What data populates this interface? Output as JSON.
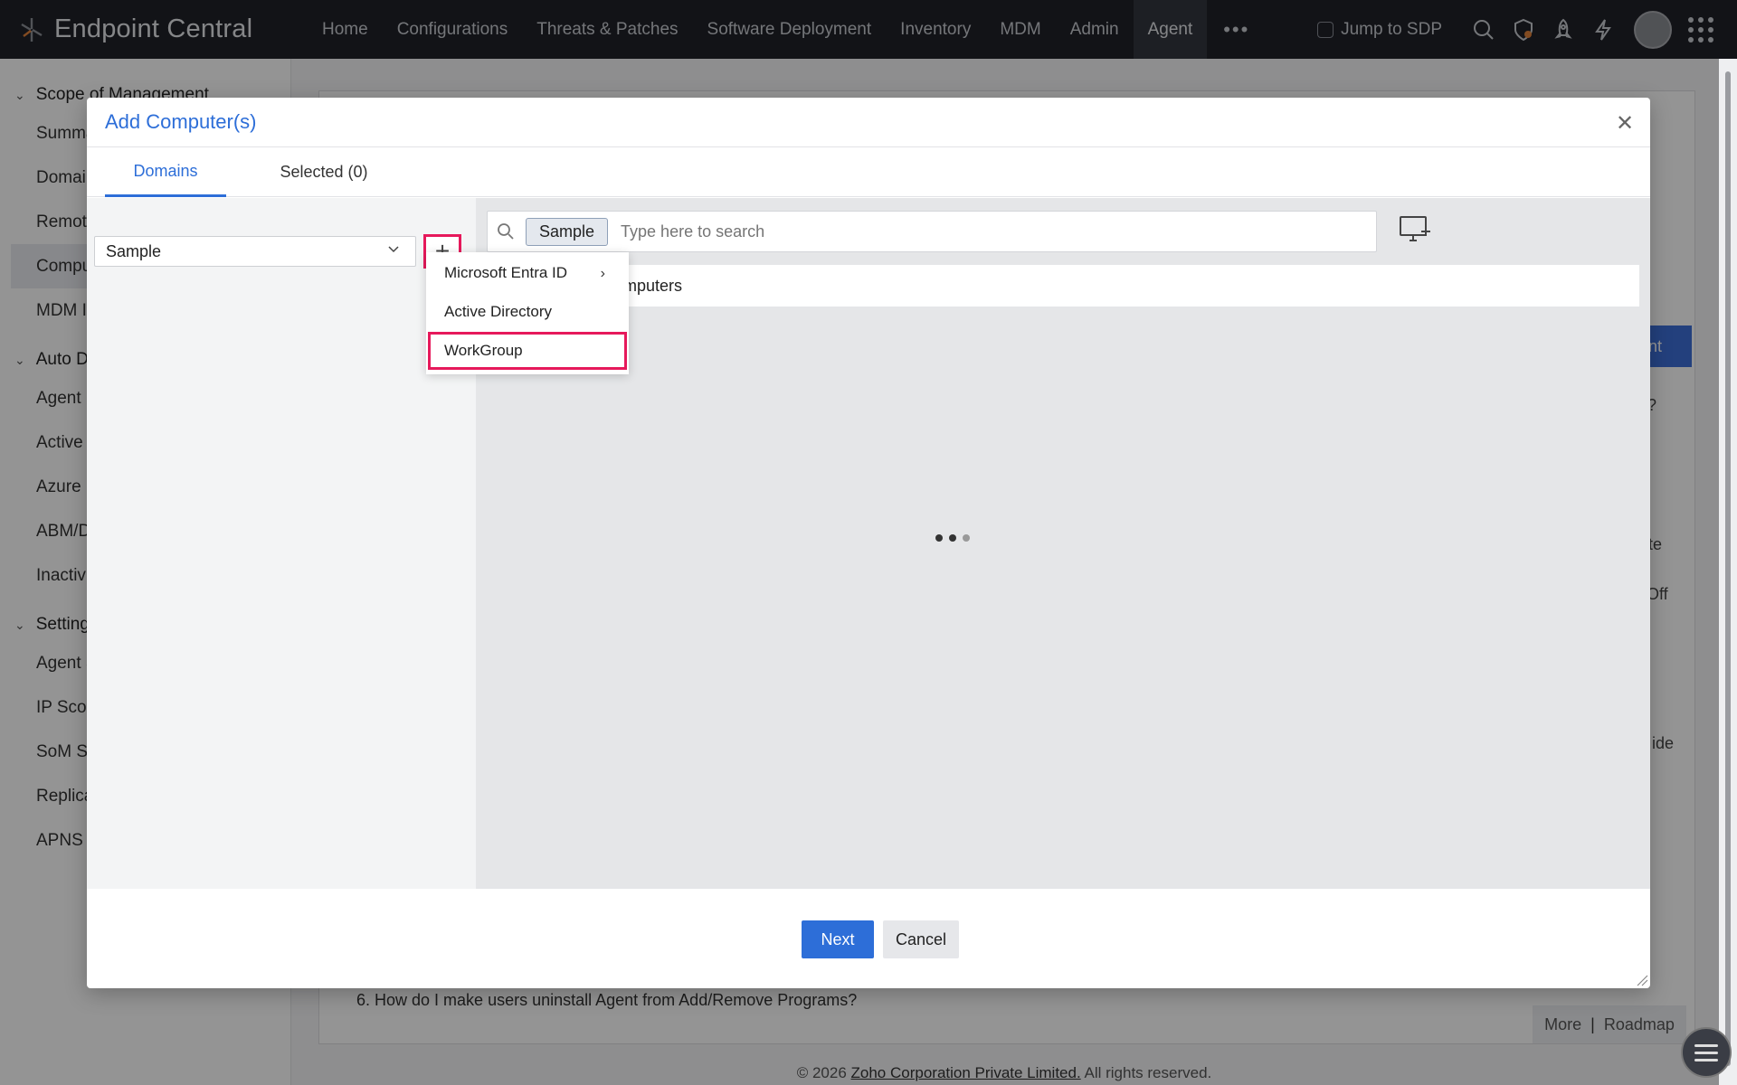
{
  "app": {
    "title": "Endpoint Central",
    "nav": [
      "Home",
      "Configurations",
      "Threats & Patches",
      "Software Deployment",
      "Inventory",
      "MDM",
      "Admin",
      "Agent"
    ],
    "active_nav": "Agent",
    "more": "•••",
    "jump_label": "Jump to SDP"
  },
  "sidebar": {
    "sections": [
      {
        "label": "Scope of Management",
        "items": [
          "Summa",
          "Domai",
          "Remot",
          "Compu",
          "MDM I"
        ]
      },
      {
        "label": "Auto D",
        "items": [
          "Agent",
          "Active",
          "Azure",
          "ABM/D",
          "Inactiv"
        ]
      },
      {
        "label": "Setting",
        "items": [
          "Agent S",
          "IP Scop",
          "SoM Se",
          "Replica",
          "APNS C"
        ]
      }
    ]
  },
  "background": {
    "faq_item": "6. How do I make users uninstall Agent from Add/Remove Programs?",
    "more_label": "More",
    "roadmap_label": "Roadmap",
    "footer_prefix": "© 2026 ",
    "footer_company": "Zoho Corporation Private Limited.",
    "footer_suffix": " All rights reserved.",
    "agent_btn": "gent",
    "partial_texts": {
      "q": "s?",
      "te": "te",
      "off": "Off",
      "ide": "ide"
    }
  },
  "modal": {
    "title": "Add Computer(s)",
    "tabs": {
      "domains": "Domains",
      "selected": "Selected (0)"
    },
    "domain_select": "Sample",
    "dropdown": [
      "Microsoft Entra ID",
      "Active Directory",
      "WorkGroup"
    ],
    "search": {
      "chip": "Sample",
      "placeholder": "Type here to search"
    },
    "computers_label": "Computers",
    "buttons": {
      "next": "Next",
      "cancel": "Cancel"
    }
  }
}
